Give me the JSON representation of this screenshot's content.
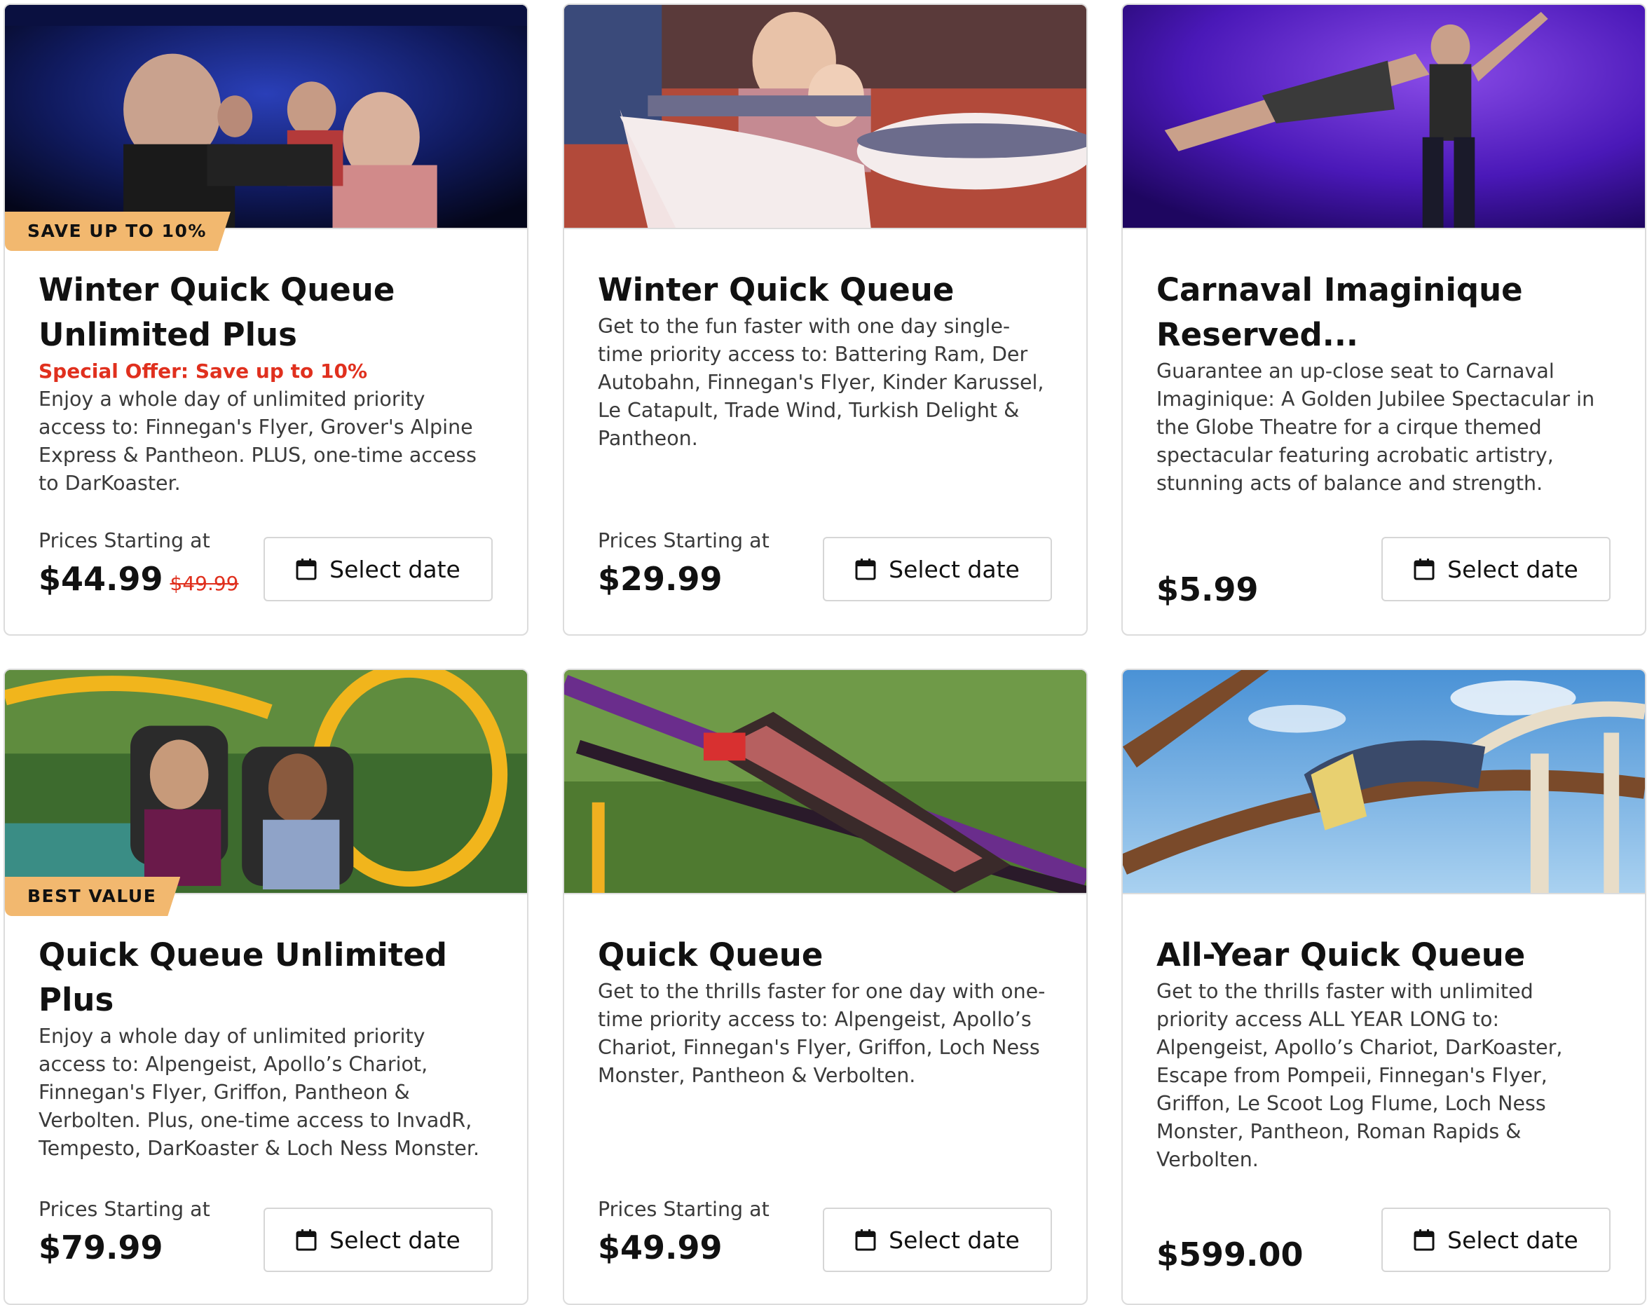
{
  "cards": [
    {
      "badge": "SAVE UP TO 10%",
      "title": "Winter Quick Queue Unlimited Plus",
      "offer": "Special Offer: Save up to 10%",
      "description": "Enjoy a whole day of unlimited priority access to: Finnegan's Flyer, Grover's Alpine Express & Pantheon. PLUS, one-time access to DarKoaster.",
      "prices_label": "Prices Starting at",
      "price": "$44.99",
      "old_price": "$49.99",
      "button_label": "Select date"
    },
    {
      "title": "Winter Quick Queue",
      "description": "Get to the fun faster with one day single-time priority access to: Battering Ram, Der Autobahn, Finnegan's Flyer, Kinder Karussel, Le Catapult, Trade Wind, Turkish Delight & Pantheon.",
      "prices_label": "Prices Starting at",
      "price": "$29.99",
      "button_label": "Select date"
    },
    {
      "title": "Carnaval Imaginique Reserved...",
      "description": "Guarantee an up-close seat to Carnaval Imaginique: A Golden Jubilee Spectacular in the Globe Theatre for a cirque themed spectacular featuring acrobatic artistry, stunning acts of balance and strength.",
      "price": "$5.99",
      "button_label": "Select date"
    },
    {
      "badge": "BEST VALUE",
      "title": "Quick Queue Unlimited Plus",
      "description": "Enjoy a whole day of unlimited priority access to: Alpengeist, Apollo’s Chariot, Finnegan's Flyer, Griffon, Pantheon & Verbolten. Plus, one-time access to InvadR, Tempesto, DarKoaster & Loch Ness Monster.",
      "prices_label": "Prices Starting at",
      "price": "$79.99",
      "button_label": "Select date"
    },
    {
      "title": "Quick Queue",
      "description": "Get to the thrills faster for one day with one-time priority access to: Alpengeist, Apollo’s Chariot, Finnegan's Flyer, Griffon, Loch Ness Monster, Pantheon & Verbolten.",
      "prices_label": "Prices Starting at",
      "price": "$49.99",
      "button_label": "Select date"
    },
    {
      "title": "All-Year Quick Queue",
      "description": "Get to the thrills faster with unlimited priority access ALL YEAR LONG to: Alpengeist, Apollo’s Chariot, DarKoaster, Escape from Pompeii, Finnegan's Flyer, Griffon, Le Scoot Log Flume, Loch Ness Monster, Pantheon, Roman Rapids & Verbolten.",
      "price": "$599.00",
      "button_label": "Select date"
    }
  ],
  "icons": {
    "button_icon": "calendar-icon"
  },
  "colors": {
    "badge": "#f2b86f",
    "offer": "#e0301e",
    "border": "#dcdcdc"
  }
}
